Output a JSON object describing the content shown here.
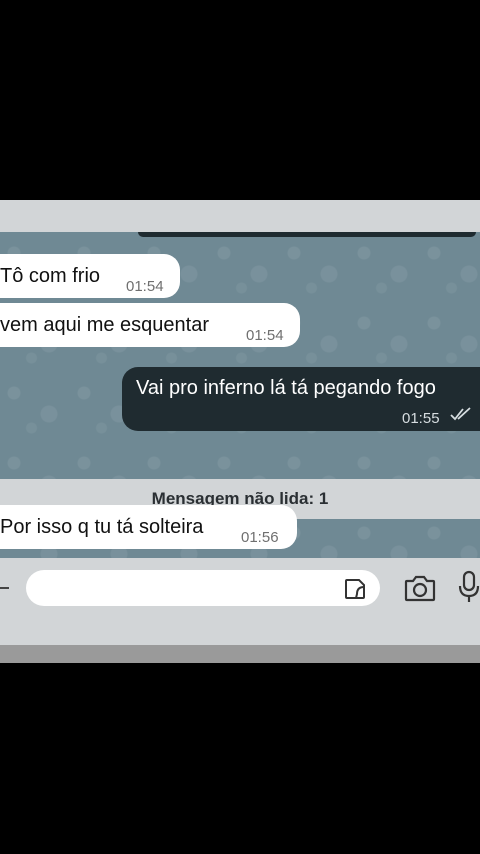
{
  "messages": [
    {
      "direction": "incoming",
      "text": "Tô com frio",
      "time": "01:54"
    },
    {
      "direction": "incoming",
      "text": "vem aqui me esquentar",
      "time": "01:54"
    },
    {
      "direction": "outgoing",
      "text": "Vai pro inferno lá tá pegando fogo",
      "time": "01:55",
      "status_icon": "double-check-icon"
    },
    {
      "direction": "incoming",
      "text": "Por isso q tu tá solteira",
      "time": "01:56"
    }
  ],
  "unread_divider": "Mensagem não lida: 1",
  "input": {
    "placeholder": "",
    "icons": [
      "attach-icon",
      "sticker-icon",
      "camera-icon",
      "microphone-icon"
    ]
  },
  "colors": {
    "chat_background": "#6f8994",
    "incoming_bubble": "#ffffff",
    "outgoing_bubble": "#1f2b30",
    "bar": "#d2d5d7"
  }
}
